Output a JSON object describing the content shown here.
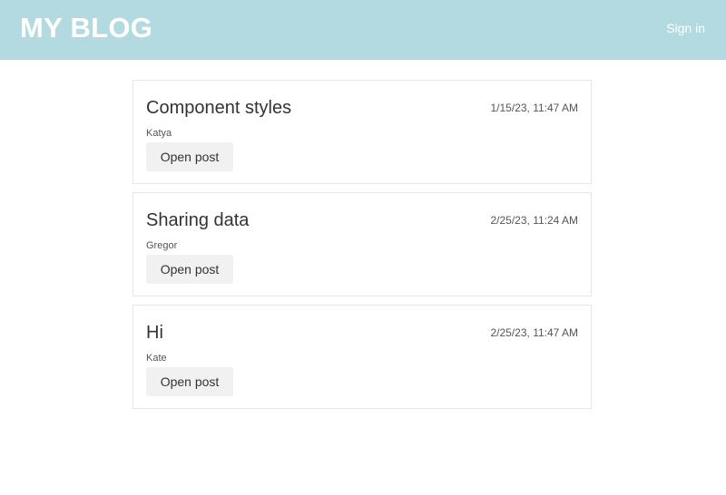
{
  "header": {
    "brand": "MY BLOG",
    "signin_label": "Sign in",
    "background_color": "#b2dae0"
  },
  "posts": [
    {
      "title": "Component styles",
      "date": "1/15/23, 11:47 AM",
      "author": "Katya",
      "button_label": "Open post"
    },
    {
      "title": "Sharing data",
      "date": "2/25/23, 11:24 AM",
      "author": "Gregor",
      "button_label": "Open post"
    },
    {
      "title": "Hi",
      "date": "2/25/23, 11:47 AM",
      "author": "Kate",
      "button_label": "Open post"
    }
  ]
}
